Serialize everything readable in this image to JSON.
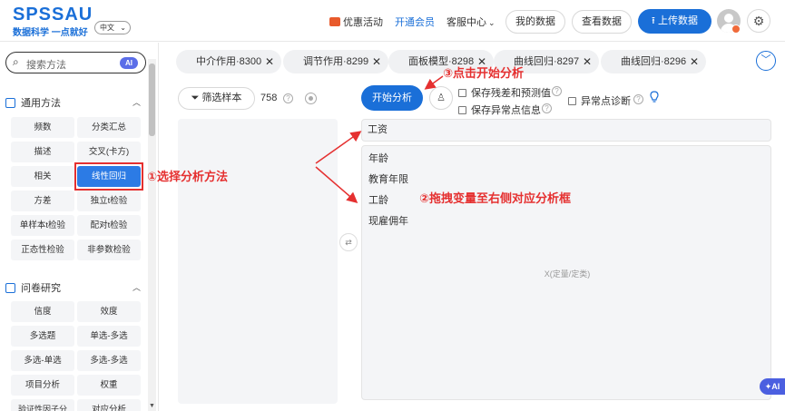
{
  "header": {
    "logo_text": "SPSSAU",
    "logo_slogan": "数据科学 一点就好",
    "language": "中文",
    "promo": "优惠活动",
    "vip": "开通会员",
    "service": "客服中心",
    "my_data": "我的数据",
    "view_data": "查看数据",
    "upload": "上传数据",
    "icons": {
      "upload": "upload-icon",
      "settings": "gear-icon",
      "avatar": "user-avatar"
    }
  },
  "sidebar": {
    "search_placeholder": "搜索方法",
    "ai_label": "AI",
    "sections": [
      {
        "title": "通用方法",
        "items": [
          "频数",
          "分类汇总",
          "描述",
          "交叉(卡方)",
          "相关",
          "线性回归",
          "方差",
          "独立t检验",
          "单样本t检验",
          "配对t检验",
          "正态性检验",
          "非参数检验"
        ],
        "active": "线性回归"
      },
      {
        "title": "问卷研究",
        "items": [
          "信度",
          "效度",
          "多选题",
          "单选-多选",
          "多选-单选",
          "多选-多选",
          "项目分析",
          "权重",
          "验证性因子分",
          "对应分析"
        ]
      }
    ]
  },
  "tabs": [
    {
      "label": "中介作用·8300"
    },
    {
      "label": "调节作用·8299"
    },
    {
      "label": "面板模型·8298"
    },
    {
      "label": "曲线回归·8297"
    },
    {
      "label": "曲线回归·8296"
    }
  ],
  "toolbar": {
    "filter_label": "筛选样本",
    "sample_count": "758",
    "start_label": "开始分析",
    "checkboxes": [
      {
        "label": "保存残差和预测值",
        "checked": false
      },
      {
        "label": "保存异常点信息",
        "checked": false
      },
      {
        "label": "异常点诊断",
        "checked": false
      }
    ]
  },
  "analysis": {
    "y_variable": "工资",
    "x_variables": [
      "年龄",
      "教育年限",
      "工龄",
      "现雇佣年"
    ],
    "x_placeholder": "X(定量/定类)"
  },
  "annotations": {
    "step1": "①选择分析方法",
    "step2": "②拖拽变量至右侧对应分析框",
    "step3": "③点击开始分析"
  },
  "ai_button": "AI",
  "colors": {
    "primary": "#1a6fd8",
    "annotation": "#e53030",
    "active_item": "#2c7be5"
  }
}
